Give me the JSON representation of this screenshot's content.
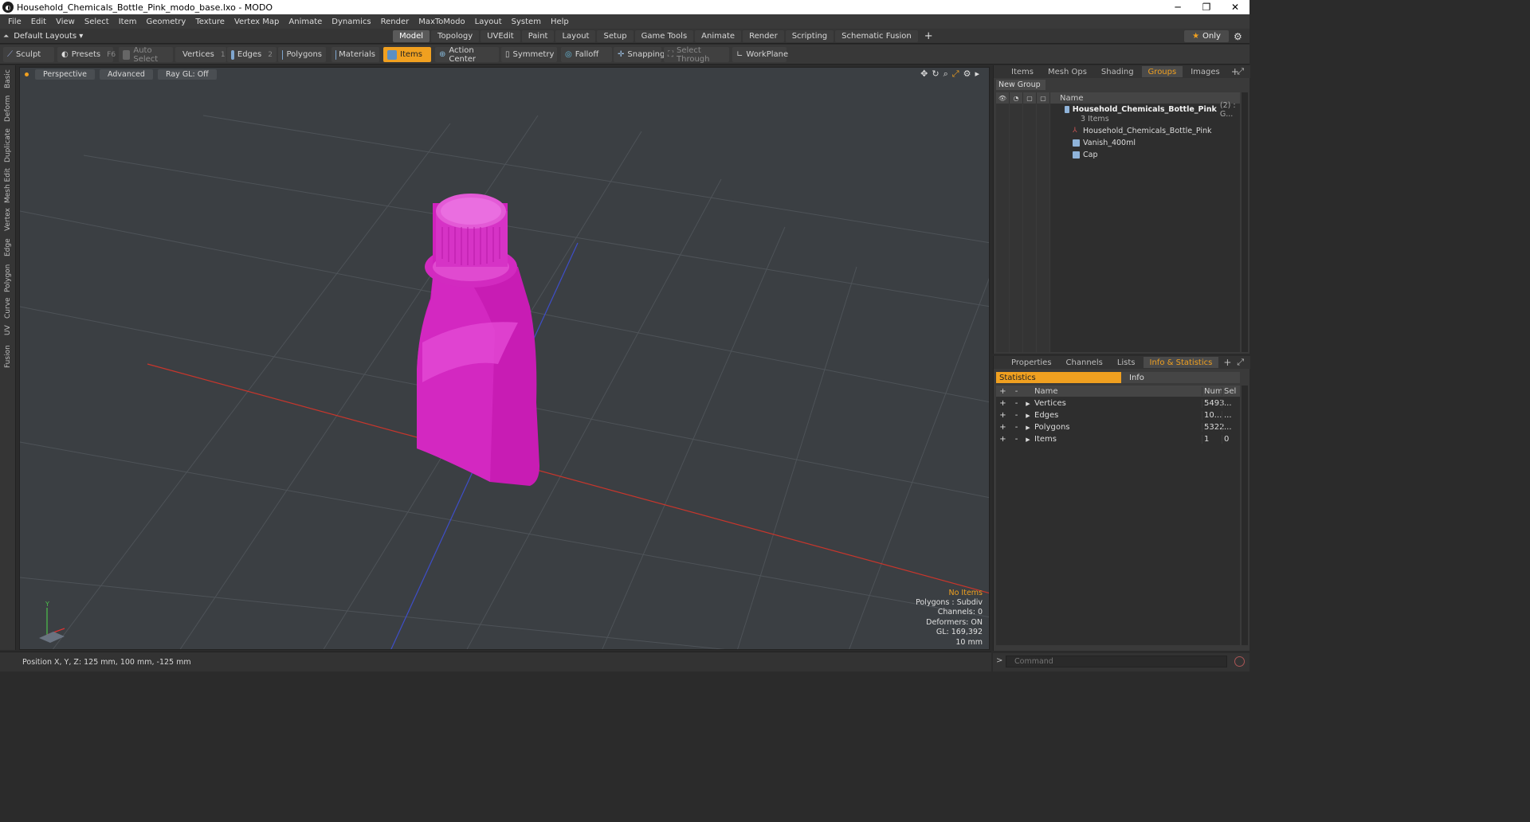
{
  "window": {
    "title": "Household_Chemicals_Bottle_Pink_modo_base.lxo - MODO",
    "minimize": "─",
    "maximize": "❐",
    "close": "✕"
  },
  "menu": [
    "File",
    "Edit",
    "View",
    "Select",
    "Item",
    "Geometry",
    "Texture",
    "Vertex Map",
    "Animate",
    "Dynamics",
    "Render",
    "MaxToModo",
    "Layout",
    "System",
    "Help"
  ],
  "layouts": {
    "default_label": "Default Layouts ▾"
  },
  "tabs": [
    "Model",
    "Topology",
    "UVEdit",
    "Paint",
    "Layout",
    "Setup",
    "Game Tools",
    "Animate",
    "Render",
    "Scripting",
    "Schematic Fusion"
  ],
  "tabs_active": "Model",
  "only_label": "Only",
  "toolbar": {
    "sculpt": "Sculpt",
    "presets": "Presets",
    "presets_key": "F6",
    "auto_select": "Auto Select",
    "vertices": "Vertices",
    "vertices_key": "1",
    "edges": "Edges",
    "edges_key": "2",
    "polygons": "Polygons",
    "materials": "Materials",
    "items": "Items",
    "action_center": "Action Center",
    "symmetry": "Symmetry",
    "falloff": "Falloff",
    "snapping": "Snapping",
    "select_through": "Select Through",
    "workplane": "WorkPlane"
  },
  "left_tabs": [
    "Basic",
    "Deform",
    "Duplicate",
    "Mesh Edit",
    "Vertex",
    "Edge",
    "Polygon",
    "Curve",
    "UV",
    "Fusion"
  ],
  "viewport": {
    "perspective": "Perspective",
    "advanced": "Advanced",
    "raygl": "Ray GL: Off",
    "stats": {
      "no_items": "No Items",
      "polygons": "Polygons : Subdiv",
      "channels": "Channels: 0",
      "deformers": "Deformers: ON",
      "gl": "GL: 169,392",
      "scale": "10 mm"
    },
    "gizmo_y": "Y",
    "bottle_color": "#d41ec0"
  },
  "status": {
    "position": "Position X, Y, Z:   125 mm, 100 mm, -125 mm"
  },
  "right_top": {
    "tabs": [
      "Items",
      "Mesh Ops",
      "Shading",
      "Groups",
      "Images"
    ],
    "active_tab": "Groups",
    "new_group": "New Group",
    "name_header": "Name",
    "group": {
      "name": "Household_Chemicals_Bottle_Pink",
      "suffix": "(2) : G...",
      "count": "3 Items"
    },
    "children": [
      "Household_Chemicals_Bottle_Pink",
      "Vanish_400ml",
      "Cap"
    ]
  },
  "right_bottom": {
    "tabs": [
      "Properties",
      "Channels",
      "Lists",
      "Info & Statistics"
    ],
    "active_tab": "Info & Statistics",
    "statistics": "Statistics",
    "info": "Info",
    "headers": {
      "name": "Name",
      "num": "Num",
      "sel": "Sel"
    },
    "rows": [
      {
        "name": "Vertices",
        "num": "5493",
        "sel": "..."
      },
      {
        "name": "Edges",
        "num": "10...",
        "sel": "..."
      },
      {
        "name": "Polygons",
        "num": "5322",
        "sel": "..."
      },
      {
        "name": "Items",
        "num": "1",
        "sel": "0"
      }
    ]
  },
  "command": {
    "placeholder": "Command",
    "prompt": ">"
  },
  "colors": {
    "accent": "#f0a020",
    "bottle": "#d41ec0",
    "viewport_bg": "#3b3f43"
  }
}
